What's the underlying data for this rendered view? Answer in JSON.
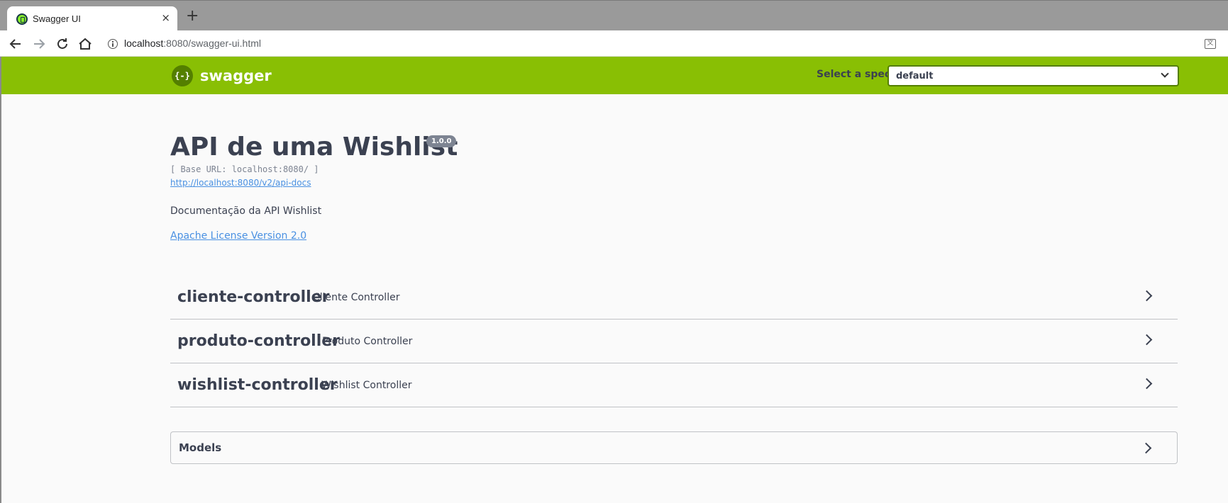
{
  "browser": {
    "tab_title": "Swagger UI",
    "tab_close": "×",
    "new_tab": "+",
    "url_host": "localhost",
    "url_path": ":8080/swagger-ui.html",
    "translate_glyph": "文"
  },
  "topbar": {
    "logo_mark": "{-}",
    "logo_text": "swagger",
    "spec_label": "Select a spec",
    "spec_value": "default"
  },
  "info": {
    "title": "API de uma Wishlist",
    "version": "1.0.0",
    "base_url": "[ Base URL: localhost:8080/ ]",
    "docs_link": "http://localhost:8080/v2/api-docs",
    "description": "Documentação da API Wishlist",
    "license": "Apache License Version 2.0"
  },
  "tags": [
    {
      "name": "cliente-controller",
      "description": "Cliente Controller"
    },
    {
      "name": "produto-controller",
      "description": "Produto Controller"
    },
    {
      "name": "wishlist-controller",
      "description": "Wishlist Controller"
    }
  ],
  "models": {
    "title": "Models"
  },
  "colors": {
    "topbar": "#89bf04",
    "link": "#4990e2",
    "text": "#3b4151",
    "badge": "#7d8492"
  }
}
